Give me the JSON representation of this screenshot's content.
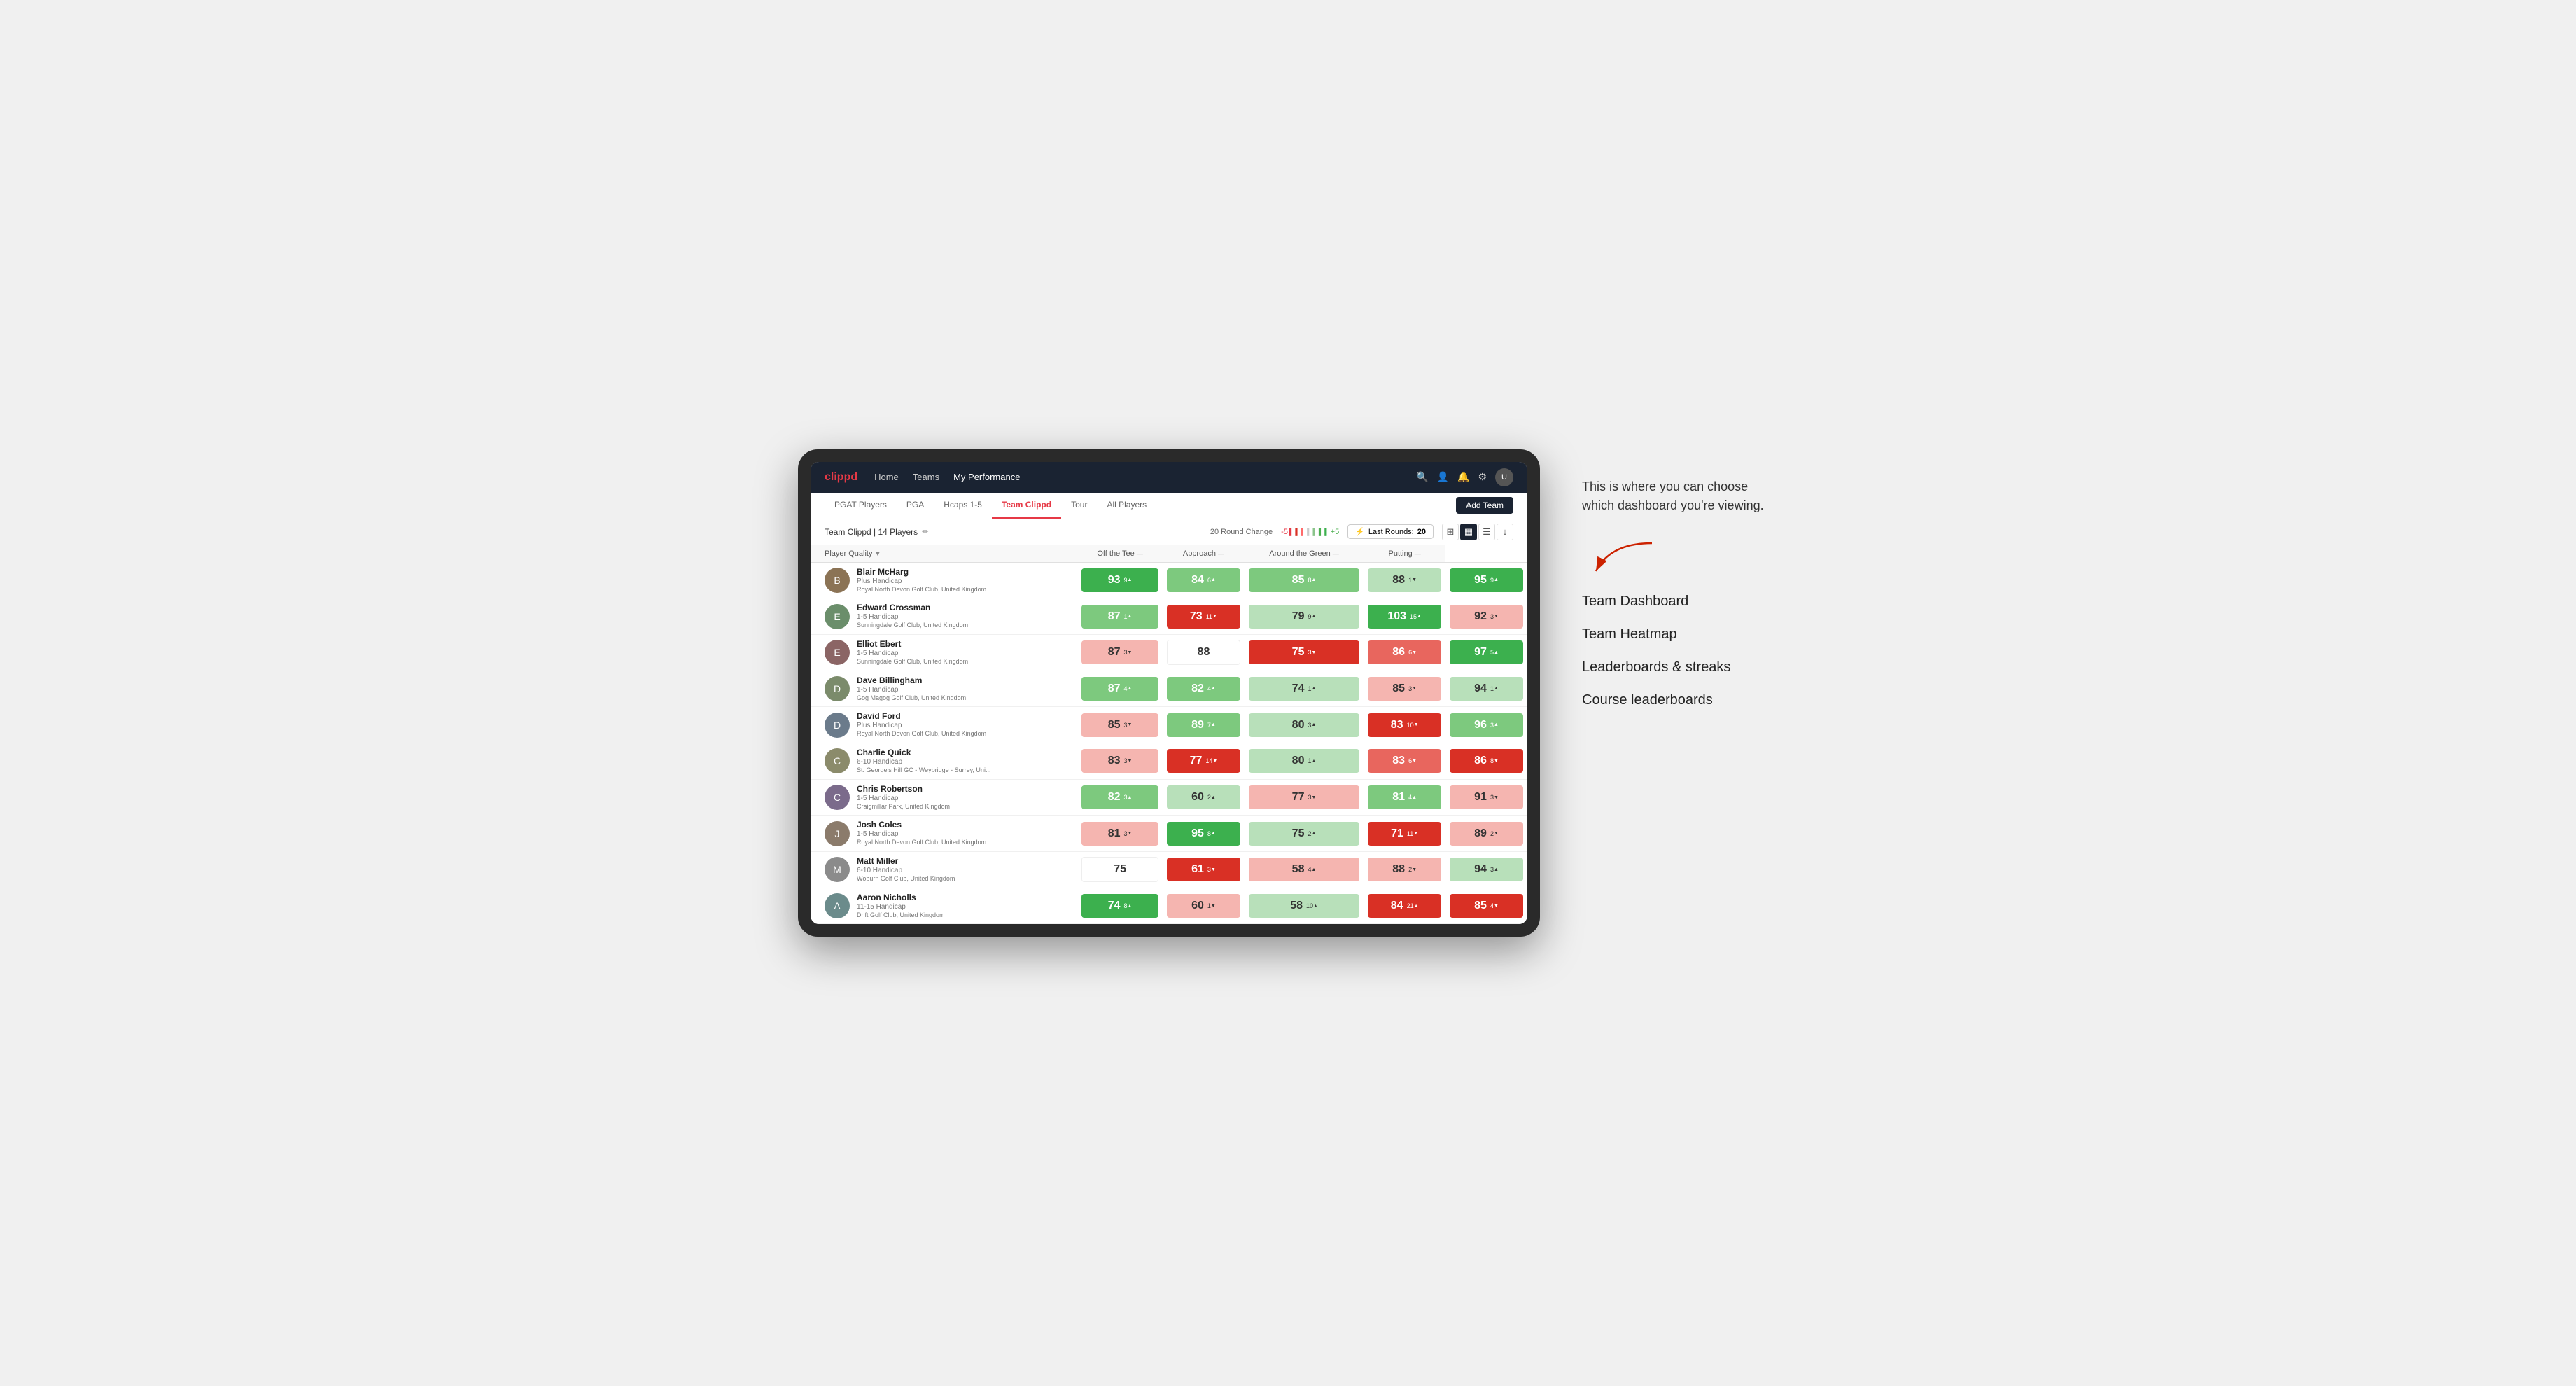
{
  "annotation": {
    "intro_text": "This is where you can choose which dashboard you're viewing.",
    "menu_items": [
      "Team Dashboard",
      "Team Heatmap",
      "Leaderboards & streaks",
      "Course leaderboards"
    ]
  },
  "nav": {
    "logo": "clippd",
    "links": [
      "Home",
      "Teams",
      "My Performance"
    ],
    "active_link": "My Performance"
  },
  "sub_nav": {
    "tabs": [
      "PGAT Players",
      "PGA",
      "Hcaps 1-5",
      "Team Clippd",
      "Tour",
      "All Players"
    ],
    "active_tab": "Team Clippd",
    "add_team_label": "Add Team"
  },
  "team_header": {
    "team_name": "Team Clippd | 14 Players",
    "round_change_label": "20 Round Change",
    "round_change_neg": "-5",
    "round_change_pos": "+5",
    "last_rounds_label": "Last Rounds:",
    "last_rounds_value": "20"
  },
  "table": {
    "columns": [
      {
        "id": "player",
        "label": "Player Quality",
        "sortable": true
      },
      {
        "id": "tee",
        "label": "Off the Tee",
        "sortable": true
      },
      {
        "id": "approach",
        "label": "Approach",
        "sortable": true
      },
      {
        "id": "around",
        "label": "Around the Green",
        "sortable": true
      },
      {
        "id": "putting",
        "label": "Putting",
        "sortable": true
      }
    ],
    "rows": [
      {
        "name": "Blair McHarg",
        "hcp": "Plus Handicap",
        "club": "Royal North Devon Golf Club, United Kingdom",
        "avatar_color": "#8B7355",
        "scores": [
          {
            "val": "93",
            "delta": "9",
            "dir": "up",
            "color": "green-dark"
          },
          {
            "val": "84",
            "delta": "6",
            "dir": "up",
            "color": "green-light"
          },
          {
            "val": "85",
            "delta": "8",
            "dir": "up",
            "color": "green-light"
          },
          {
            "val": "88",
            "delta": "1",
            "dir": "down",
            "color": "green-pale"
          },
          {
            "val": "95",
            "delta": "9",
            "dir": "up",
            "color": "green-dark"
          }
        ]
      },
      {
        "name": "Edward Crossman",
        "hcp": "1-5 Handicap",
        "club": "Sunningdale Golf Club, United Kingdom",
        "avatar_color": "#6B8E6B",
        "scores": [
          {
            "val": "87",
            "delta": "1",
            "dir": "up",
            "color": "green-light"
          },
          {
            "val": "73",
            "delta": "11",
            "dir": "down",
            "color": "red-dark"
          },
          {
            "val": "79",
            "delta": "9",
            "dir": "up",
            "color": "green-pale"
          },
          {
            "val": "103",
            "delta": "15",
            "dir": "up",
            "color": "green-dark"
          },
          {
            "val": "92",
            "delta": "3",
            "dir": "down",
            "color": "red-pale"
          }
        ]
      },
      {
        "name": "Elliot Ebert",
        "hcp": "1-5 Handicap",
        "club": "Sunningdale Golf Club, United Kingdom",
        "avatar_color": "#8B6565",
        "scores": [
          {
            "val": "87",
            "delta": "3",
            "dir": "down",
            "color": "red-pale"
          },
          {
            "val": "88",
            "delta": "",
            "dir": "",
            "color": "white-bg"
          },
          {
            "val": "75",
            "delta": "3",
            "dir": "down",
            "color": "red-dark"
          },
          {
            "val": "86",
            "delta": "6",
            "dir": "down",
            "color": "red-light"
          },
          {
            "val": "97",
            "delta": "5",
            "dir": "up",
            "color": "green-dark"
          }
        ]
      },
      {
        "name": "Dave Billingham",
        "hcp": "1-5 Handicap",
        "club": "Gog Magog Golf Club, United Kingdom",
        "avatar_color": "#7B8B6B",
        "scores": [
          {
            "val": "87",
            "delta": "4",
            "dir": "up",
            "color": "green-light"
          },
          {
            "val": "82",
            "delta": "4",
            "dir": "up",
            "color": "green-light"
          },
          {
            "val": "74",
            "delta": "1",
            "dir": "up",
            "color": "green-pale"
          },
          {
            "val": "85",
            "delta": "3",
            "dir": "down",
            "color": "red-pale"
          },
          {
            "val": "94",
            "delta": "1",
            "dir": "up",
            "color": "green-pale"
          }
        ]
      },
      {
        "name": "David Ford",
        "hcp": "Plus Handicap",
        "club": "Royal North Devon Golf Club, United Kingdom",
        "avatar_color": "#6B7B8B",
        "scores": [
          {
            "val": "85",
            "delta": "3",
            "dir": "down",
            "color": "red-pale"
          },
          {
            "val": "89",
            "delta": "7",
            "dir": "up",
            "color": "green-light"
          },
          {
            "val": "80",
            "delta": "3",
            "dir": "up",
            "color": "green-pale"
          },
          {
            "val": "83",
            "delta": "10",
            "dir": "down",
            "color": "red-dark"
          },
          {
            "val": "96",
            "delta": "3",
            "dir": "up",
            "color": "green-light"
          }
        ]
      },
      {
        "name": "Charlie Quick",
        "hcp": "6-10 Handicap",
        "club": "St. George's Hill GC - Weybridge - Surrey, Uni...",
        "avatar_color": "#8B8B6B",
        "scores": [
          {
            "val": "83",
            "delta": "3",
            "dir": "down",
            "color": "red-pale"
          },
          {
            "val": "77",
            "delta": "14",
            "dir": "down",
            "color": "red-dark"
          },
          {
            "val": "80",
            "delta": "1",
            "dir": "up",
            "color": "green-pale"
          },
          {
            "val": "83",
            "delta": "6",
            "dir": "down",
            "color": "red-light"
          },
          {
            "val": "86",
            "delta": "8",
            "dir": "down",
            "color": "red-dark"
          }
        ]
      },
      {
        "name": "Chris Robertson",
        "hcp": "1-5 Handicap",
        "club": "Craigmillar Park, United Kingdom",
        "avatar_color": "#7B6B8B",
        "scores": [
          {
            "val": "82",
            "delta": "3",
            "dir": "up",
            "color": "green-light"
          },
          {
            "val": "60",
            "delta": "2",
            "dir": "up",
            "color": "green-pale"
          },
          {
            "val": "77",
            "delta": "3",
            "dir": "down",
            "color": "red-pale"
          },
          {
            "val": "81",
            "delta": "4",
            "dir": "up",
            "color": "green-light"
          },
          {
            "val": "91",
            "delta": "3",
            "dir": "down",
            "color": "red-pale"
          }
        ]
      },
      {
        "name": "Josh Coles",
        "hcp": "1-5 Handicap",
        "club": "Royal North Devon Golf Club, United Kingdom",
        "avatar_color": "#8B7B6B",
        "scores": [
          {
            "val": "81",
            "delta": "3",
            "dir": "down",
            "color": "red-pale"
          },
          {
            "val": "95",
            "delta": "8",
            "dir": "up",
            "color": "green-dark"
          },
          {
            "val": "75",
            "delta": "2",
            "dir": "up",
            "color": "green-pale"
          },
          {
            "val": "71",
            "delta": "11",
            "dir": "down",
            "color": "red-dark"
          },
          {
            "val": "89",
            "delta": "2",
            "dir": "down",
            "color": "red-pale"
          }
        ]
      },
      {
        "name": "Matt Miller",
        "hcp": "6-10 Handicap",
        "club": "Woburn Golf Club, United Kingdom",
        "avatar_color": "#8B8B8B",
        "scores": [
          {
            "val": "75",
            "delta": "",
            "dir": "",
            "color": "white-bg"
          },
          {
            "val": "61",
            "delta": "3",
            "dir": "down",
            "color": "red-dark"
          },
          {
            "val": "58",
            "delta": "4",
            "dir": "up",
            "color": "red-pale"
          },
          {
            "val": "88",
            "delta": "2",
            "dir": "down",
            "color": "red-pale"
          },
          {
            "val": "94",
            "delta": "3",
            "dir": "up",
            "color": "green-pale"
          }
        ]
      },
      {
        "name": "Aaron Nicholls",
        "hcp": "11-15 Handicap",
        "club": "Drift Golf Club, United Kingdom",
        "avatar_color": "#6B8B8B",
        "scores": [
          {
            "val": "74",
            "delta": "8",
            "dir": "up",
            "color": "green-dark"
          },
          {
            "val": "60",
            "delta": "1",
            "dir": "down",
            "color": "red-pale"
          },
          {
            "val": "58",
            "delta": "10",
            "dir": "up",
            "color": "green-pale"
          },
          {
            "val": "84",
            "delta": "21",
            "dir": "up",
            "color": "red-dark"
          },
          {
            "val": "85",
            "delta": "4",
            "dir": "down",
            "color": "red-dark"
          }
        ]
      }
    ]
  }
}
